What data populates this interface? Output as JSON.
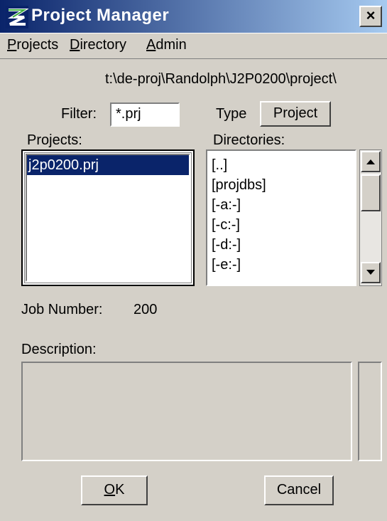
{
  "window": {
    "title": "Project Manager",
    "close_label": "×"
  },
  "menu": {
    "projects": {
      "prefix": "P",
      "rest": "rojects"
    },
    "directory": {
      "prefix": "D",
      "rest": "irectory"
    },
    "admin": {
      "prefix": "A",
      "rest": "dmin"
    }
  },
  "path": "t:\\de-proj\\Randolph\\J2P0200\\project\\",
  "filter": {
    "label": "Filter:",
    "value": "*.prj"
  },
  "type": {
    "label": "Type",
    "button": "Project"
  },
  "projects": {
    "label": "Projects:",
    "items": [
      "j2p0200.prj"
    ],
    "selected": "j2p0200.prj"
  },
  "directories": {
    "label": "Directories:",
    "items": [
      "[..]",
      "[projdbs]",
      "[-a:-]",
      "[-c:-]",
      "[-d:-]",
      "[-e:-]"
    ]
  },
  "job": {
    "label": "Job Number:",
    "value": "200"
  },
  "description": {
    "label": "Description:",
    "value": ""
  },
  "buttons": {
    "ok": {
      "prefix": "O",
      "rest": "K"
    },
    "cancel": "Cancel"
  },
  "icons": {
    "app": "project-manager-app-icon",
    "close": "close-icon",
    "scroll_up": "arrow-up-icon",
    "scroll_down": "arrow-down-icon"
  },
  "colors": {
    "title_start": "#0a246a",
    "title_end": "#a6caf0",
    "face": "#d4d0c8",
    "selection": "#0a246a"
  }
}
